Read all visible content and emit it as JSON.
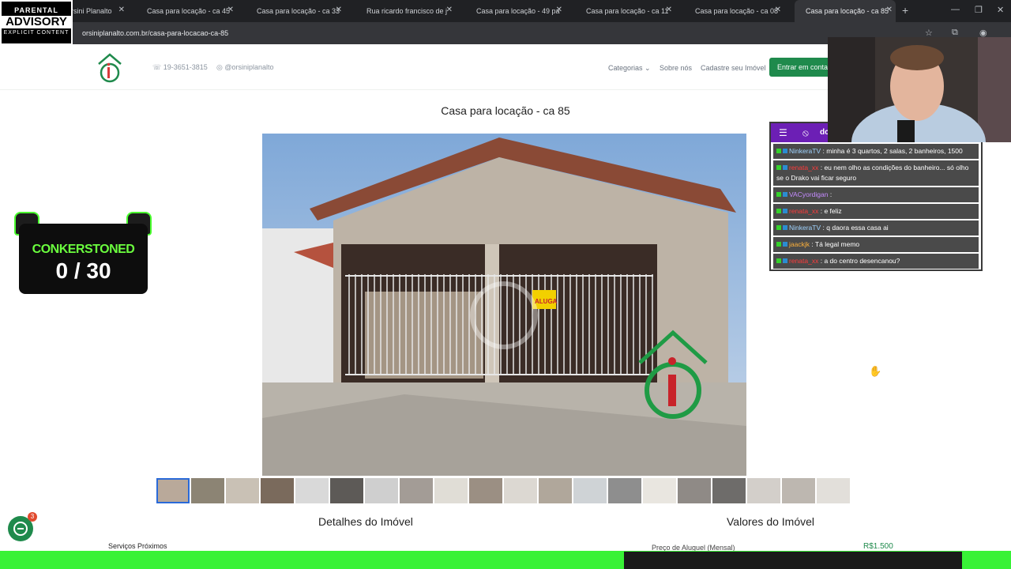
{
  "browser": {
    "tabs": [
      {
        "title": "rsini Planalto"
      },
      {
        "title": "Casa para locação - ca 45"
      },
      {
        "title": "Casa para locação - ca 33"
      },
      {
        "title": "Rua ricardo francisco de j"
      },
      {
        "title": "Casa para locação - 49 pa"
      },
      {
        "title": "Casa para locação - ca 11"
      },
      {
        "title": "Casa para locação - ca 08"
      },
      {
        "title": "Casa para locação - ca 85"
      }
    ],
    "url": "orsiniplanalto.com.br/casa-para-locacao-ca-85"
  },
  "overlay_badge": {
    "line1": "PARENTAL",
    "line2": "ADVISORY",
    "line3": "EXPLICIT CONTENT"
  },
  "header": {
    "phone": "19-3651-3815",
    "instagram": "@orsiniplanalto",
    "nav": {
      "categorias": "Categorias",
      "sobre": "Sobre nós",
      "cadastre": "Cadastre seu Imóvel"
    },
    "cta": "Entrar em contat"
  },
  "page": {
    "title": "Casa para locação - ca 85",
    "photo_sign": "ALUGA",
    "details_title": "Detalhes do Imóvel",
    "values_title": "Valores do Imóvel",
    "services": "Serviços Próximos",
    "price_label": "Preço de Aluguel (Mensal)",
    "price_value": "R$1.500",
    "thumbnail_count": 20
  },
  "stream": {
    "counter_name": "CONKERSTONED",
    "counter_value": "0 / 30",
    "chat_partial_title": "dc",
    "chat": [
      {
        "user": "NinkeraTV",
        "text": ": minha é 3 quartos, 2 salas, 2 banheiros, 1500",
        "user_color": "#9fd3ff"
      },
      {
        "user": "renata_xx",
        "text": ": eu nem olho as condições do banheiro... só olho se o Drako vai ficar seguro",
        "user_color": "#ff3b3b"
      },
      {
        "user": "VACyordigan",
        "text": ":",
        "user_color": "#c58bff"
      },
      {
        "user": "renata_xx",
        "text": ": e feliz",
        "user_color": "#ff3b3b"
      },
      {
        "user": "NinkeraTV",
        "text": ": q daora essa casa ai",
        "user_color": "#9fd3ff"
      },
      {
        "user": "jaackjk",
        "text": ": Tá legal memo",
        "user_color": "#ffb23b"
      },
      {
        "user": "renata_xx",
        "text": ": a do centro desencanou?",
        "user_color": "#ff3b3b"
      }
    ],
    "support_badge": "3"
  },
  "colors": {
    "brand_green": "#1f8a4c",
    "stream_green": "#38f236",
    "chat_purple": "#6c1fb5"
  }
}
